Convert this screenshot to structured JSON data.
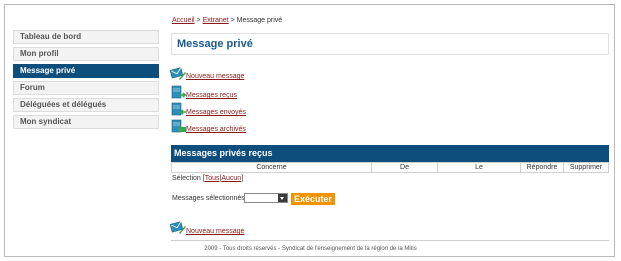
{
  "sidebar": {
    "items": [
      {
        "label": "Tableau de bord",
        "active": false
      },
      {
        "label": "Mon profil",
        "active": false
      },
      {
        "label": "Message privé",
        "active": true
      },
      {
        "label": "Forum",
        "active": false
      },
      {
        "label": "Déléguées et délégués",
        "active": false
      },
      {
        "label": "Mon syndicat",
        "active": false
      }
    ]
  },
  "breadcrumb": {
    "home": "Accueil",
    "sep1": " > ",
    "extranet": "Extranet",
    "sep2": " > ",
    "current": "Message privé"
  },
  "page_title": "Message privé",
  "links": {
    "new_message": {
      "label": "Nouveau message",
      "icon": "new-message-icon"
    },
    "received": {
      "label": "Messages reçus",
      "icon": "inbox-icon"
    },
    "sent": {
      "label": "Messages envoyés",
      "icon": "sent-icon"
    },
    "archived": {
      "label": "Messages archivés",
      "icon": "archive-icon"
    }
  },
  "section_title": "Messages privés reçus",
  "table": {
    "columns": [
      "Concerne",
      "De",
      "Le",
      "Répondre",
      "Supprimer"
    ]
  },
  "selection": {
    "label": "Sélection ",
    "all": "Tous",
    "separator": "|",
    "none": "Aucun",
    "open_bracket": "[",
    "close_bracket": "]"
  },
  "bulk": {
    "label": "Messages sélectionnés",
    "selected_value": "",
    "button": "Exécuter"
  },
  "bottom_link": "Nouveau message",
  "footer": "2009 - Tous droits réservés - Syndicat de l'enseignement de la région de la Mitis",
  "colors": {
    "primary": "#0e4e7c",
    "link": "#8b1a1a",
    "button": "#f29400"
  }
}
